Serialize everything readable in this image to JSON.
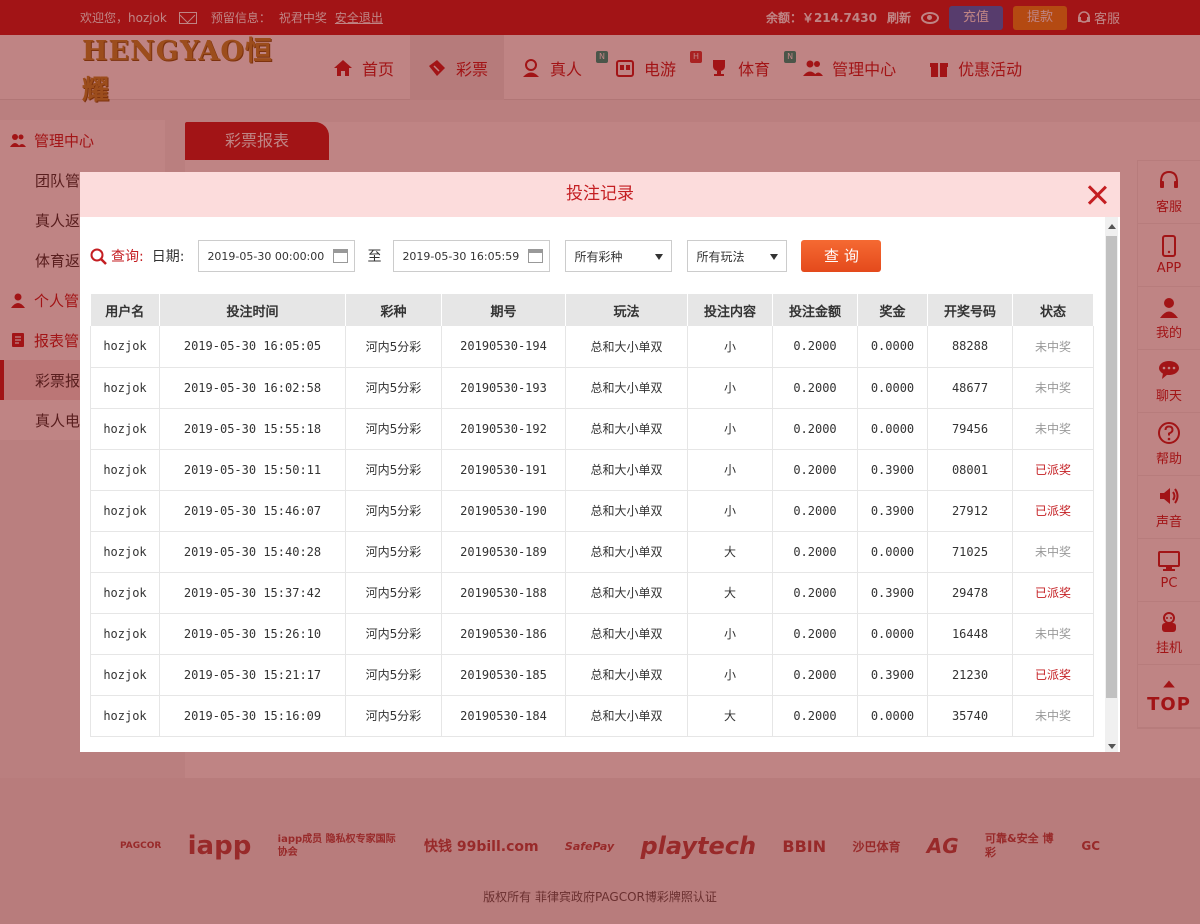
{
  "topbar": {
    "welcome": "欢迎您，hozjok",
    "reserve_label": "预留信息：",
    "reserve_value": "祝君中奖",
    "logout": "安全退出",
    "balance_label": "余额：",
    "balance_value": "￥214.7430",
    "refresh": "刷新",
    "deposit": "充值",
    "withdraw": "提款",
    "service": "客服"
  },
  "header": {
    "logo_text": "HENGYAO恒耀",
    "nav": [
      {
        "label": "首页",
        "icon": "home-icon"
      },
      {
        "label": "彩票",
        "icon": "lottery-ticket-icon"
      },
      {
        "label": "真人",
        "icon": "live-dealer-icon",
        "badge": "N"
      },
      {
        "label": "电游",
        "icon": "slot-game-icon",
        "badge": "H"
      },
      {
        "label": "体育",
        "icon": "sports-trophy-icon",
        "badge": "N"
      },
      {
        "label": "管理中心",
        "icon": "users-icon"
      },
      {
        "label": "优惠活动",
        "icon": "gift-icon"
      }
    ]
  },
  "sidebar": {
    "items": [
      {
        "label": "管理中心",
        "type": "head"
      },
      {
        "label": "团队管"
      },
      {
        "label": "真人返"
      },
      {
        "label": "体育返"
      },
      {
        "label": "个人管",
        "type": "head"
      },
      {
        "label": "报表管",
        "type": "head"
      },
      {
        "label": "彩票报",
        "type": "active"
      },
      {
        "label": "真人电"
      }
    ]
  },
  "content": {
    "tab": "彩票报表"
  },
  "right_float": [
    {
      "label": "客服",
      "icon": "headset-icon"
    },
    {
      "label": "APP",
      "icon": "mobile-phone-icon"
    },
    {
      "label": "我的",
      "icon": "user-profile-icon"
    },
    {
      "label": "聊天",
      "icon": "chat-bubble-icon"
    },
    {
      "label": "帮助",
      "icon": "help-question-icon"
    },
    {
      "label": "声音",
      "icon": "speaker-icon"
    },
    {
      "label": "PC",
      "icon": "monitor-icon"
    },
    {
      "label": "挂机",
      "icon": "robot-icon"
    },
    {
      "label": "TOP",
      "icon": "arrow-up-icon"
    }
  ],
  "footer": {
    "partners": [
      "PAGCOR",
      "iapp",
      "iapp成员 隐私权专家国际协会",
      "快钱 99bill.com",
      "SafePay",
      "playtech",
      "BBIN",
      "沙巴体育",
      "AG",
      "可靠&安全 博彩",
      "GC"
    ],
    "copyright": "版权所有 菲律宾政府PAGCOR博彩牌照认证"
  },
  "modal": {
    "title": "投注记录",
    "filter": {
      "query_label": "查询:",
      "date_label": "日期:",
      "start_date": "2019-05-30 00:00:00",
      "to_label": "至",
      "end_date": "2019-05-30 16:05:59",
      "lottery_select": "所有彩种",
      "play_select": "所有玩法",
      "search_button": "查 询"
    },
    "columns": [
      "用户名",
      "投注时间",
      "彩种",
      "期号",
      "玩法",
      "投注内容",
      "投注金额",
      "奖金",
      "开奖号码",
      "状态"
    ],
    "rows": [
      [
        "hozjok",
        "2019-05-30 16:05:05",
        "河内5分彩",
        "20190530-194",
        "总和大小单双",
        "小",
        "0.2000",
        "0.0000",
        "88288",
        "未中奖"
      ],
      [
        "hozjok",
        "2019-05-30 16:02:58",
        "河内5分彩",
        "20190530-193",
        "总和大小单双",
        "小",
        "0.2000",
        "0.0000",
        "48677",
        "未中奖"
      ],
      [
        "hozjok",
        "2019-05-30 15:55:18",
        "河内5分彩",
        "20190530-192",
        "总和大小单双",
        "小",
        "0.2000",
        "0.0000",
        "79456",
        "未中奖"
      ],
      [
        "hozjok",
        "2019-05-30 15:50:11",
        "河内5分彩",
        "20190530-191",
        "总和大小单双",
        "小",
        "0.2000",
        "0.3900",
        "08001",
        "已派奖"
      ],
      [
        "hozjok",
        "2019-05-30 15:46:07",
        "河内5分彩",
        "20190530-190",
        "总和大小单双",
        "小",
        "0.2000",
        "0.3900",
        "27912",
        "已派奖"
      ],
      [
        "hozjok",
        "2019-05-30 15:40:28",
        "河内5分彩",
        "20190530-189",
        "总和大小单双",
        "大",
        "0.2000",
        "0.0000",
        "71025",
        "未中奖"
      ],
      [
        "hozjok",
        "2019-05-30 15:37:42",
        "河内5分彩",
        "20190530-188",
        "总和大小单双",
        "大",
        "0.2000",
        "0.3900",
        "29478",
        "已派奖"
      ],
      [
        "hozjok",
        "2019-05-30 15:26:10",
        "河内5分彩",
        "20190530-186",
        "总和大小单双",
        "小",
        "0.2000",
        "0.0000",
        "16448",
        "未中奖"
      ],
      [
        "hozjok",
        "2019-05-30 15:21:17",
        "河内5分彩",
        "20190530-185",
        "总和大小单双",
        "小",
        "0.2000",
        "0.3900",
        "21230",
        "已派奖"
      ],
      [
        "hozjok",
        "2019-05-30 15:16:09",
        "河内5分彩",
        "20190530-184",
        "总和大小单双",
        "大",
        "0.2000",
        "0.0000",
        "35740",
        "未中奖"
      ]
    ]
  },
  "colors": {
    "brand_red": "#c41e22",
    "won_status": "#c41e22",
    "lost_status": "#999999",
    "deposit_button": "#2f6fd0",
    "withdraw_button": "#e88a1b",
    "search_button": "#ee5a26"
  }
}
